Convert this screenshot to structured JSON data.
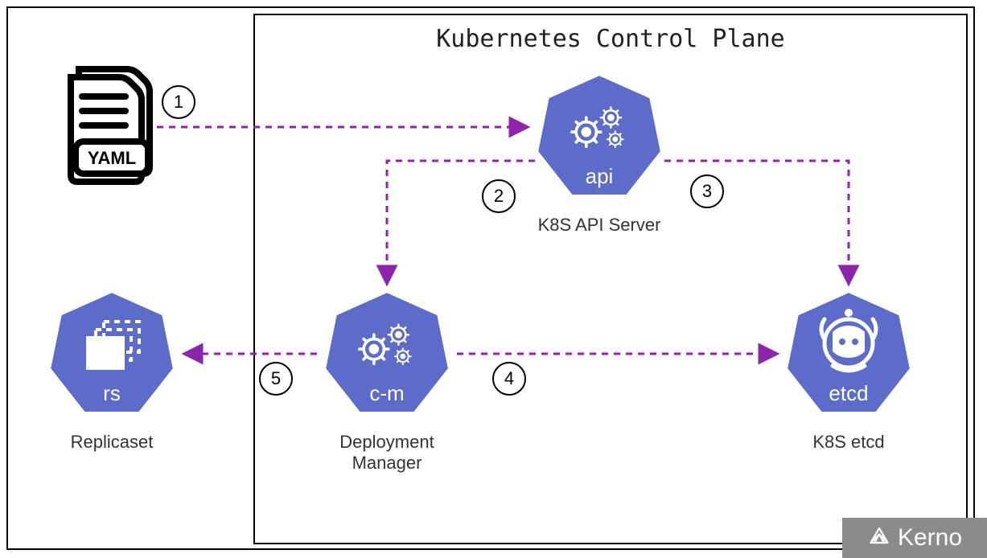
{
  "title": "Kubernetes Control Plane",
  "steps": {
    "s1": "1",
    "s2": "2",
    "s3": "3",
    "s4": "4",
    "s5": "5"
  },
  "nodes": {
    "yaml": {
      "badge": "YAML"
    },
    "api": {
      "innerLabel": "api",
      "caption": "K8S API Server"
    },
    "cm": {
      "innerLabel": "c-m",
      "caption1": "Deployment",
      "caption2": "Manager"
    },
    "etcd": {
      "innerLabel": "etcd",
      "caption": "K8S etcd"
    },
    "rs": {
      "innerLabel": "rs",
      "caption": "Replicaset"
    }
  },
  "brand": "Kerno",
  "colors": {
    "k8sBlue": "#5d6bc9",
    "arrowPurple": "#8e24aa"
  }
}
